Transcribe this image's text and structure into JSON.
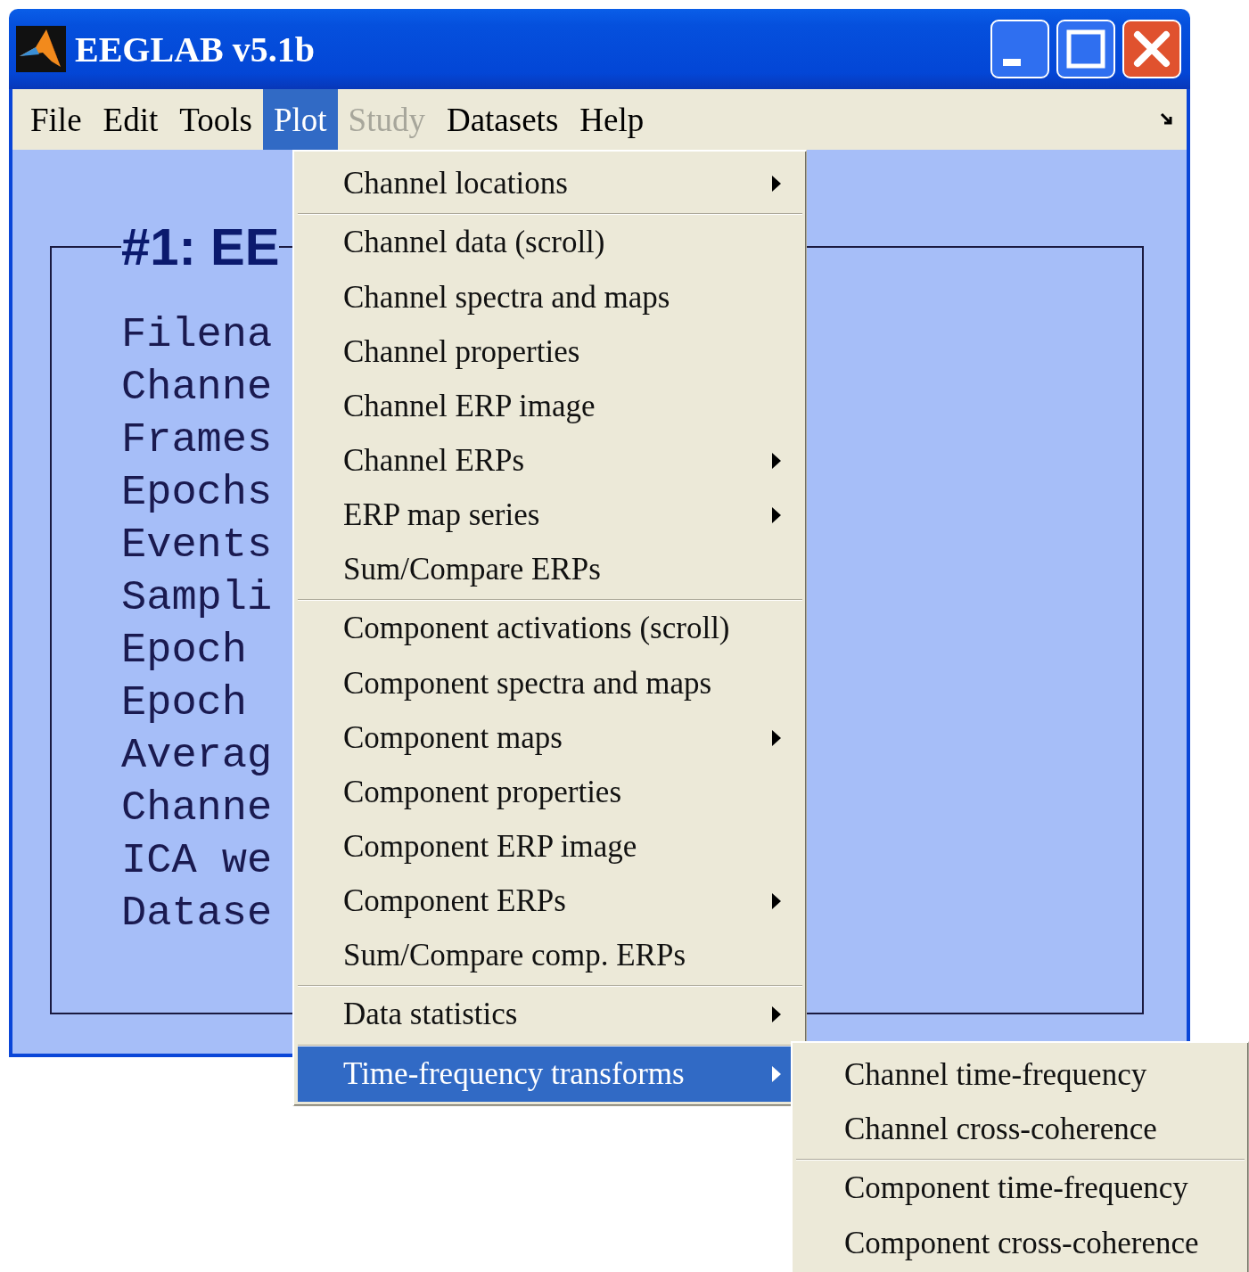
{
  "window": {
    "title": "EEGLAB v5.1b"
  },
  "menu_bar": [
    {
      "label": "File",
      "selected": false,
      "disabled": false
    },
    {
      "label": "Edit",
      "selected": false,
      "disabled": false
    },
    {
      "label": "Tools",
      "selected": false,
      "disabled": false
    },
    {
      "label": "Plot",
      "selected": true,
      "disabled": false
    },
    {
      "label": "Study",
      "selected": false,
      "disabled": true
    },
    {
      "label": "Datasets",
      "selected": false,
      "disabled": false
    },
    {
      "label": "Help",
      "selected": false,
      "disabled": false
    }
  ],
  "panel": {
    "title": "#1: EE",
    "labels": [
      "Filena",
      "Channe",
      "Frames",
      "Epochs",
      "Events",
      "Sampli",
      "Epoch",
      "Epoch",
      "Averag",
      "Channe",
      "ICA we",
      "Datase"
    ]
  },
  "plot_menu": [
    {
      "label": "Channel locations",
      "submenu": true,
      "separator_before": false,
      "selected": false
    },
    {
      "label": "Channel data (scroll)",
      "submenu": false,
      "separator_before": true,
      "selected": false
    },
    {
      "label": "Channel spectra and maps",
      "submenu": false,
      "separator_before": false,
      "selected": false
    },
    {
      "label": "Channel properties",
      "submenu": false,
      "separator_before": false,
      "selected": false
    },
    {
      "label": "Channel ERP image",
      "submenu": false,
      "separator_before": false,
      "selected": false
    },
    {
      "label": "Channel ERPs",
      "submenu": true,
      "separator_before": false,
      "selected": false
    },
    {
      "label": "ERP map series",
      "submenu": true,
      "separator_before": false,
      "selected": false
    },
    {
      "label": "Sum/Compare ERPs",
      "submenu": false,
      "separator_before": false,
      "selected": false
    },
    {
      "label": "Component activations (scroll)",
      "submenu": false,
      "separator_before": true,
      "selected": false
    },
    {
      "label": "Component spectra and maps",
      "submenu": false,
      "separator_before": false,
      "selected": false
    },
    {
      "label": "Component maps",
      "submenu": true,
      "separator_before": false,
      "selected": false
    },
    {
      "label": "Component properties",
      "submenu": false,
      "separator_before": false,
      "selected": false
    },
    {
      "label": "Component ERP image",
      "submenu": false,
      "separator_before": false,
      "selected": false
    },
    {
      "label": "Component ERPs",
      "submenu": true,
      "separator_before": false,
      "selected": false
    },
    {
      "label": "Sum/Compare comp. ERPs",
      "submenu": false,
      "separator_before": false,
      "selected": false
    },
    {
      "label": "Data statistics",
      "submenu": true,
      "separator_before": true,
      "selected": false
    },
    {
      "label": "Time-frequency transforms",
      "submenu": true,
      "separator_before": true,
      "selected": true
    }
  ],
  "submenu": [
    {
      "label": "Channel time-frequency",
      "submenu": false,
      "separator_before": false,
      "selected": false
    },
    {
      "label": "Channel cross-coherence",
      "submenu": false,
      "separator_before": false,
      "selected": false
    },
    {
      "label": "Component time-frequency",
      "submenu": false,
      "separator_before": true,
      "selected": false
    },
    {
      "label": "Component cross-coherence",
      "submenu": false,
      "separator_before": false,
      "selected": false
    }
  ]
}
